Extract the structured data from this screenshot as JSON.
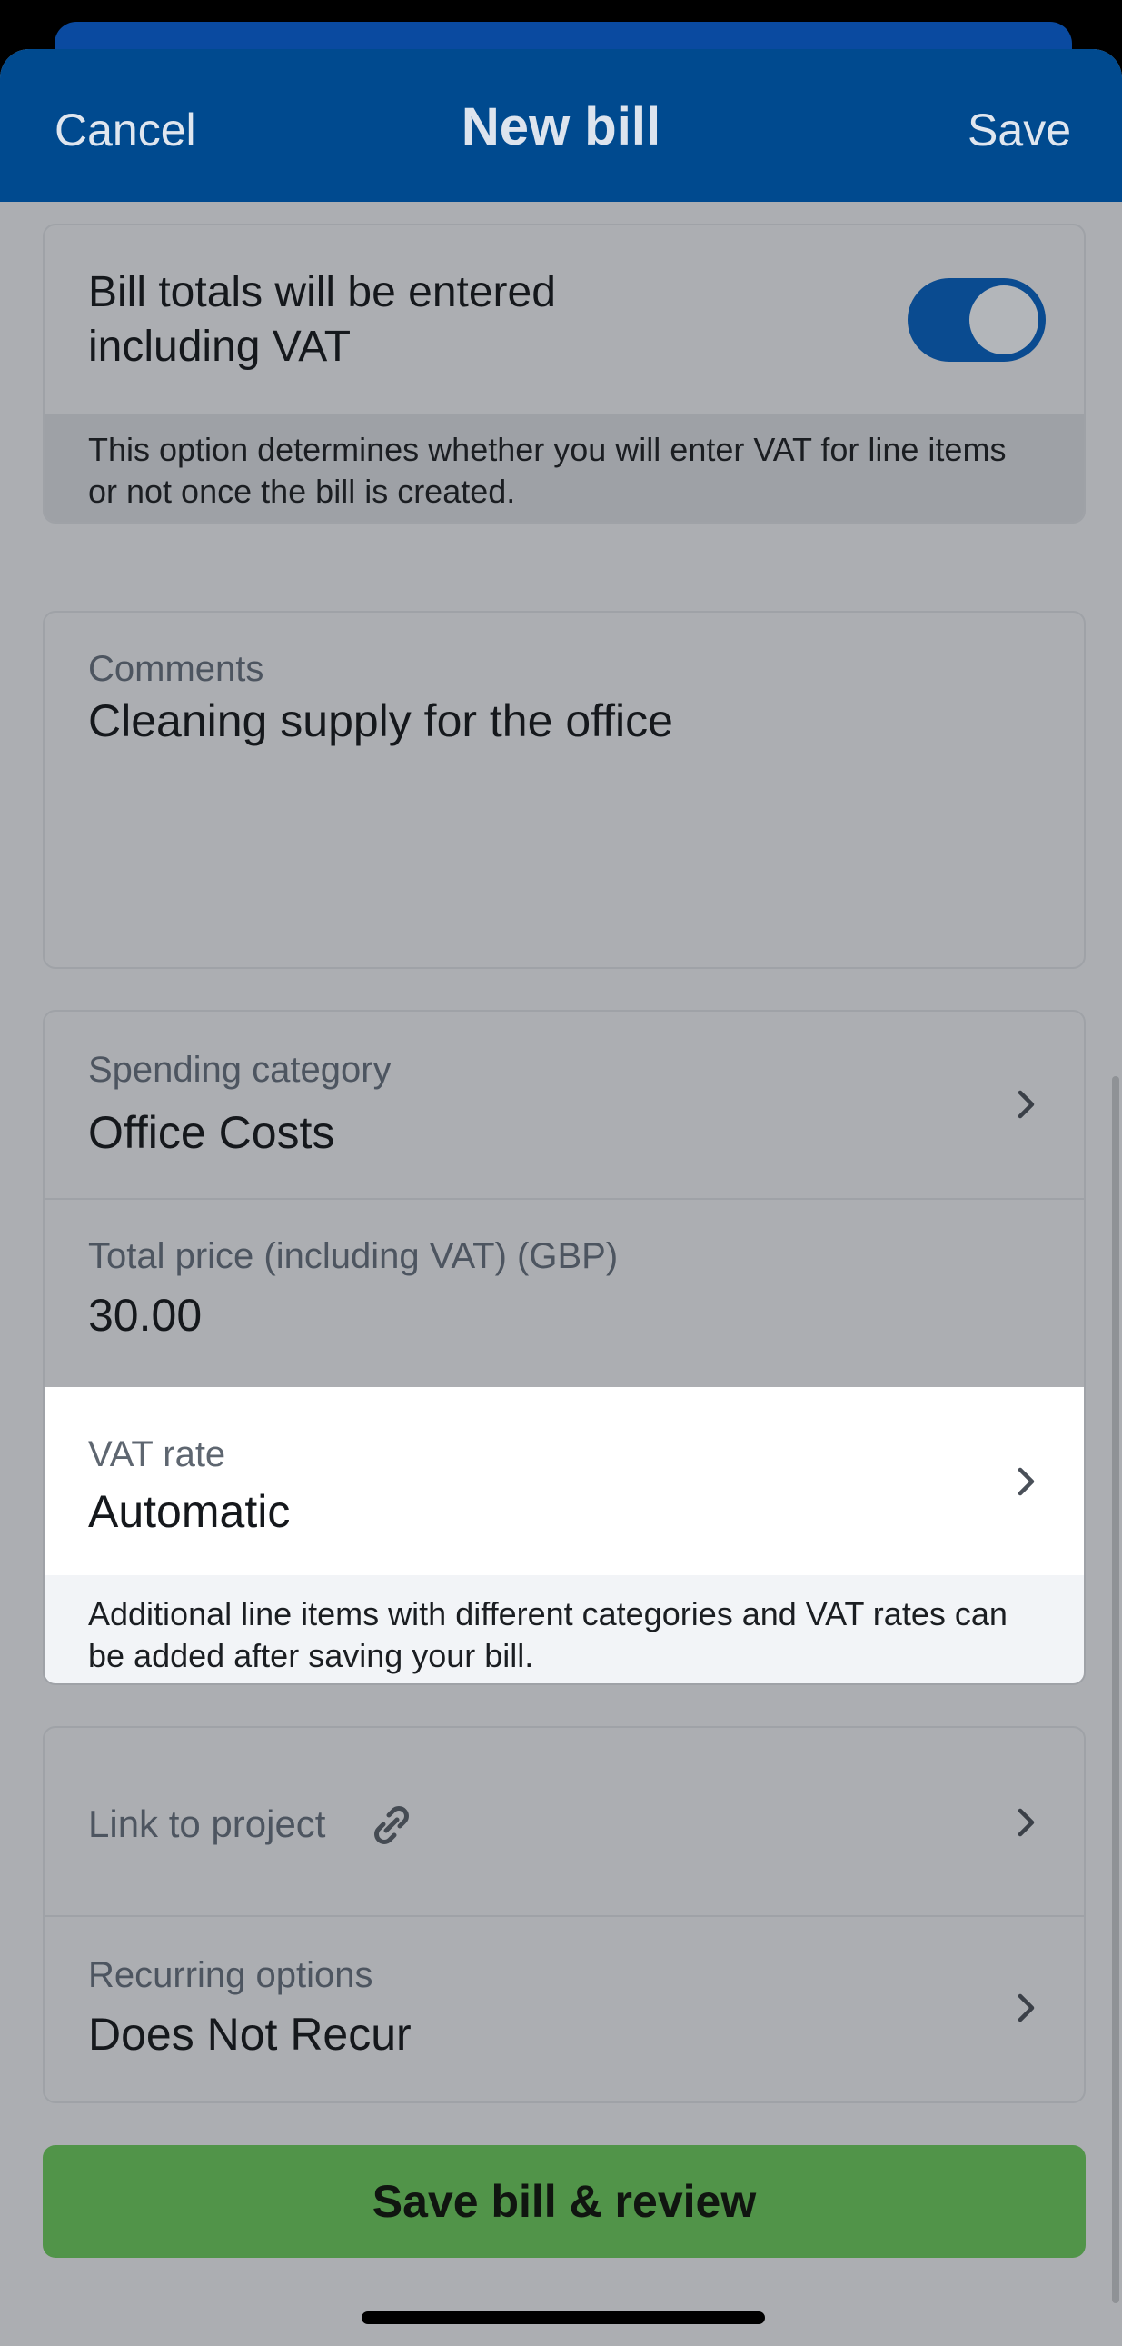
{
  "header": {
    "cancel_label": "Cancel",
    "title": "New bill",
    "save_label": "Save",
    "color": "#004a8f"
  },
  "vat_inclusive": {
    "label": "Bill totals will be entered including VAT",
    "enabled": true,
    "hint": "This option determines whether you will enter VAT for line items or not once the bill is created."
  },
  "comments": {
    "label": "Comments",
    "value": "Cleaning supply for the office"
  },
  "spending_category": {
    "label": "Spending category",
    "value": "Office Costs"
  },
  "total_price": {
    "label": "Total price (including VAT) (GBP)",
    "value": "30.00"
  },
  "vat_rate": {
    "label": "VAT rate",
    "value": "Automatic",
    "hint": "Additional line items with different categories and VAT rates can be added after saving your bill."
  },
  "project": {
    "label": "Link to project",
    "icon": "link-icon"
  },
  "recurring": {
    "label": "Recurring options",
    "value": "Does Not Recur"
  },
  "actions": {
    "save_review_label": "Save bill & review",
    "save_review_color": "#519449"
  }
}
